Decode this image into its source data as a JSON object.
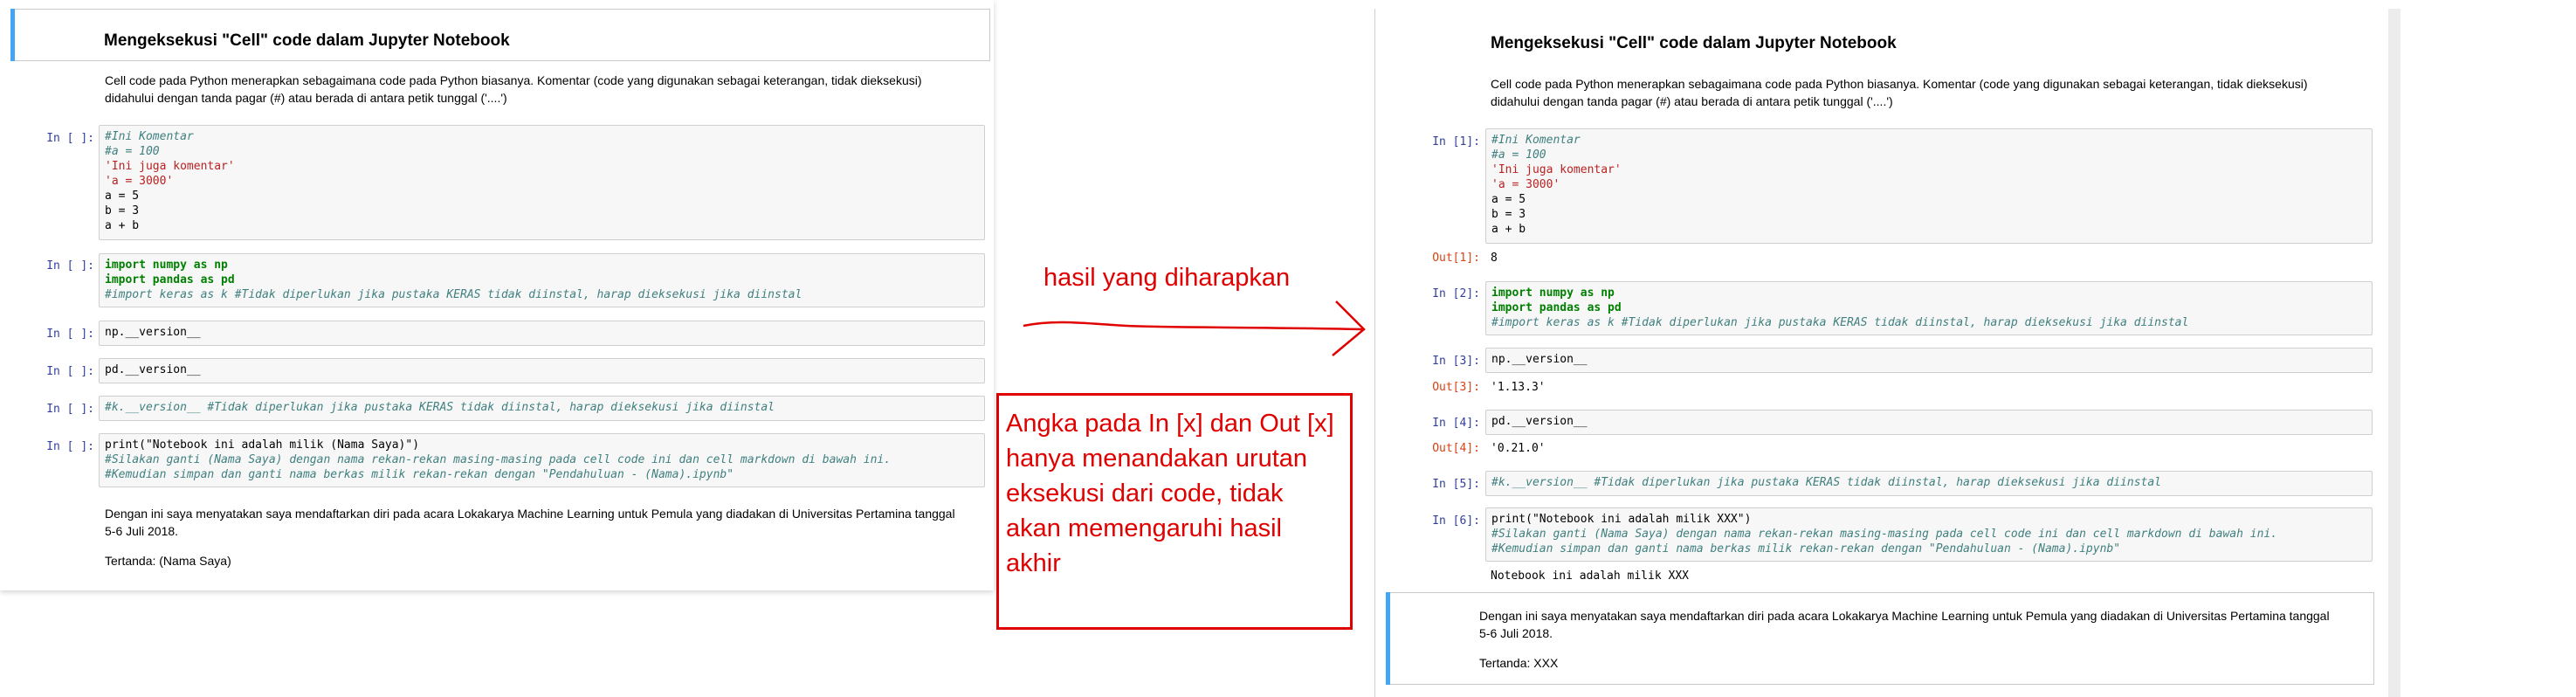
{
  "left": {
    "heading": "Mengeksekusi \"Cell\" code dalam Jupyter Notebook",
    "intro_line1": "Cell code pada Python menerapkan sebagaimana code pada Python biasanya. Komentar (code yang digunakan sebagai keterangan, tidak dieksekusi)",
    "intro_line2": "didahului dengan tanda pagar (#) atau berada di antara petik tunggal ('....')",
    "prompts": [
      "In [ ]:",
      "In [ ]:",
      "In [ ]:",
      "In [ ]:",
      "In [ ]:",
      "In [ ]:"
    ],
    "closing_line1": "Dengan ini saya menyatakan saya mendaftarkan diri pada acara Lokakarya Machine Learning untuk Pemula yang diadakan di Universitas Pertamina tanggal",
    "closing_line2": "5-6 Juli 2018.",
    "signed": "Tertanda: (Nama Saya)"
  },
  "right": {
    "heading": "Mengeksekusi \"Cell\" code dalam Jupyter Notebook",
    "intro_line1": "Cell code pada Python menerapkan sebagaimana code pada Python biasanya. Komentar (code yang digunakan sebagai keterangan, tidak dieksekusi)",
    "intro_line2": "didahului dengan tanda pagar (#) atau berada di antara petik tunggal ('....')",
    "prompts": [
      "In [1]:",
      "In [2]:",
      "In [3]:",
      "In [4]:",
      "In [5]:",
      "In [6]:"
    ],
    "out_prompts": [
      "Out[1]:",
      "Out[3]:",
      "Out[4]:"
    ],
    "outputs": [
      "8",
      "'1.13.3'",
      "'0.21.0'"
    ],
    "print_output": "Notebook ini adalah milik XXX",
    "closing_line1": "Dengan ini saya menyatakan saya mendaftarkan diri pada acara Lokakarya Machine Learning untuk Pemula yang diadakan di Universitas Pertamina tanggal",
    "closing_line2": "5-6 Juli 2018.",
    "signed": "Tertanda: XXX"
  },
  "code": {
    "c1": [
      "#Ini Komentar",
      "#a = 100",
      "'Ini juga komentar'",
      "'a = 3000'",
      "a = 5",
      "b = 3",
      "a + b"
    ],
    "c2": [
      "import numpy as np",
      "import pandas as pd",
      "#import keras as k #Tidak diperlukan jika pustaka KERAS tidak diinstal, harap dieksekusi jika diinstal"
    ],
    "c3": "np.__version__",
    "c4": "pd.__version__",
    "c5": "#k.__version__ #Tidak diperlukan jika pustaka KERAS tidak diinstal, harap dieksekusi jika diinstal",
    "c6_left": [
      "print(\"Notebook ini adalah milik (Nama Saya)\")",
      "#Silakan ganti (Nama Saya) dengan nama rekan-rekan masing-masing pada cell code ini dan cell markdown di bawah ini.",
      "#Kemudian simpan dan ganti nama berkas milik rekan-rekan dengan \"Pendahuluan - (Nama).ipynb\""
    ],
    "c6_right": [
      "print(\"Notebook ini adalah milik XXX\")",
      "#Silakan ganti (Nama Saya) dengan nama rekan-rekan masing-masing pada cell code ini dan cell markdown di bawah ini.",
      "#Kemudian simpan dan ganti nama berkas milik rekan-rekan dengan \"Pendahuluan - (Nama).ipynb\""
    ]
  },
  "annotation": {
    "arrow_label": "hasil yang diharapkan",
    "note": "Angka pada In [x] dan Out [x] hanya menandakan urutan eksekusi dari code, tidak akan memengaruhi hasil akhir",
    "color": "#e00000"
  }
}
